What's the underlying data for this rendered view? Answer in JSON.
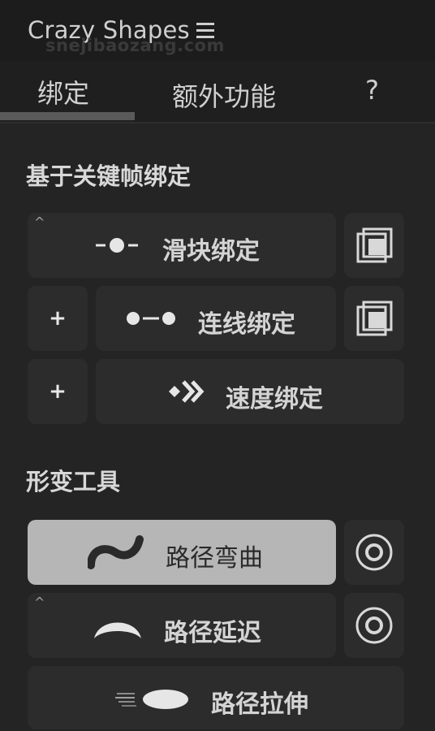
{
  "header": {
    "app_title": "Crazy Shapes",
    "menu_icon": "hamburger-menu-icon",
    "watermark": "snejibaozang.com"
  },
  "tabs": [
    {
      "label": "绑定",
      "selected": true
    },
    {
      "label": "额外功能",
      "selected": false
    },
    {
      "label": "?",
      "selected": false
    }
  ],
  "keyframe_binding": {
    "title": "基于关键帧绑定",
    "slider": {
      "label": "滑块绑定",
      "icon": "slider-icon",
      "caret": "^",
      "side_icon": "duplicate-layers-icon"
    },
    "connect": {
      "label": "连线绑定",
      "icon": "connected-dots-icon",
      "plus": "+",
      "side_icon": "duplicate-layers-icon"
    },
    "speed": {
      "label": "速度绑定",
      "icon": "speed-chevrons-icon",
      "plus": "+"
    }
  },
  "deform_tools": {
    "title": "形变工具",
    "bend": {
      "label": "路径弯曲",
      "icon": "wave-path-icon",
      "side_icon": "target-circle-icon",
      "active": true
    },
    "delay": {
      "label": "路径延迟",
      "icon": "arc-path-icon",
      "caret": "^",
      "side_icon": "target-circle-icon"
    },
    "stretch": {
      "label": "路径拉伸",
      "icon": "stretch-ellipse-icon"
    }
  },
  "colors": {
    "background": "#242424",
    "button": "#2c2c2c",
    "active_button": "#b6b6b6",
    "text": "#d4d4d4"
  }
}
